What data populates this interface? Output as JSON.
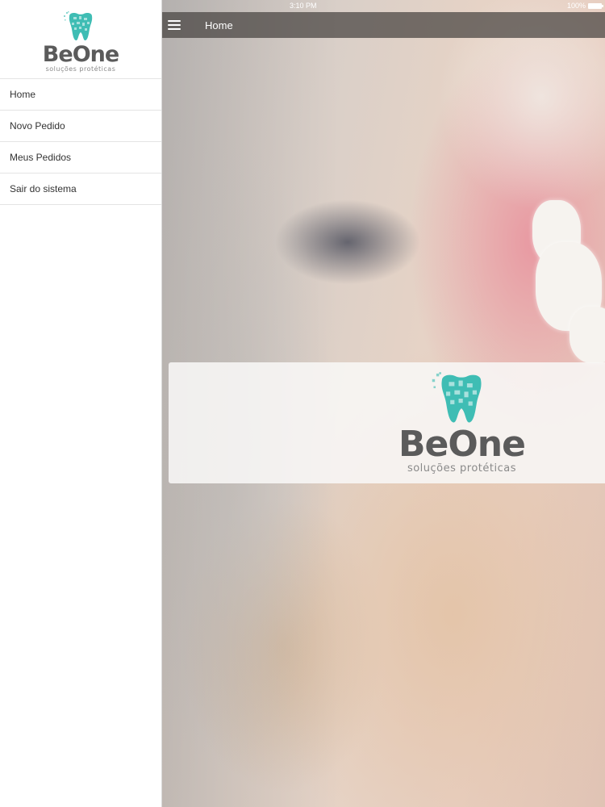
{
  "status_bar": {
    "time": "3:10 PM",
    "battery": "100%"
  },
  "brand": {
    "name": "BeOne",
    "tagline": "soluções protéticas",
    "color": "#3fbdb4"
  },
  "sidebar": {
    "items": [
      {
        "label": "Home"
      },
      {
        "label": "Novo Pedido"
      },
      {
        "label": "Meus Pedidos"
      },
      {
        "label": "Sair do sistema"
      }
    ]
  },
  "header": {
    "title": "Home",
    "menu_icon": "hamburger-icon"
  }
}
